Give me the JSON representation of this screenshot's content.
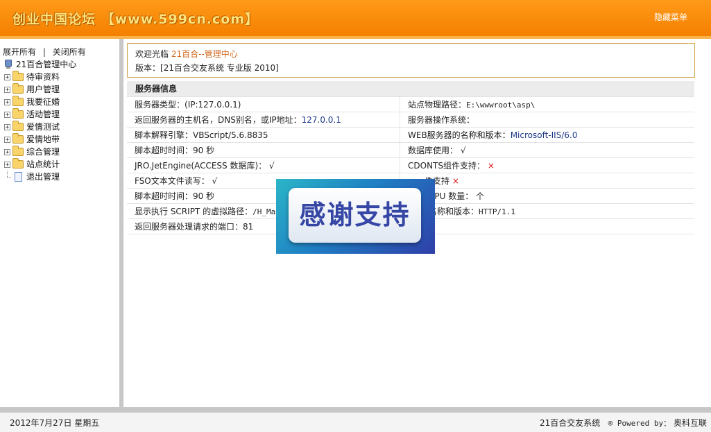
{
  "header": {
    "logo_text": "创业中国论坛 【www.599cn.com】",
    "hide_menu": "隐藏菜单"
  },
  "sidebar": {
    "expand_all": "展开所有",
    "separator": "|",
    "collapse_all": "关闭所有",
    "root": "21百合管理中心",
    "items": [
      {
        "label": "待审资料"
      },
      {
        "label": "用户管理"
      },
      {
        "label": "我要征婚"
      },
      {
        "label": "活动管理"
      },
      {
        "label": "爱情测试"
      },
      {
        "label": "爱情地带"
      },
      {
        "label": "综合管理"
      },
      {
        "label": "站点统计"
      }
    ],
    "logout": "退出管理"
  },
  "welcome": {
    "prefix": "欢迎光临",
    "center_name": "21百合--管理中心",
    "version_label": "版本：",
    "version_value": "[21百合交友系统 专业版 2010]"
  },
  "server_info": {
    "title": "服务器信息",
    "rows": [
      {
        "l_label": "服务器类型：",
        "l_value": "(IP:127.0.0.1)",
        "r_label": "站点物理路径：",
        "r_value": "E:\\wwwroot\\asp\\"
      },
      {
        "l_label": "返回服务器的主机名，DNS别名，或IP地址：",
        "l_value": "127.0.0.1",
        "r_label": "服务器操作系统：",
        "r_value": ""
      },
      {
        "l_label": "脚本解释引擎：",
        "l_value": "VBScript/5.6.8835",
        "r_label": "WEB服务器的名称和版本：",
        "r_value": "Microsoft-IIS/6.0"
      },
      {
        "l_label": "脚本超时时间：",
        "l_value": "90 秒",
        "r_label": "数据库使用：",
        "r_value": "√"
      },
      {
        "l_label": "JRO.JetEngine(ACCESS 数据库)：",
        "l_value": "√",
        "r_label": "CDONTS组件支持：",
        "r_value": "×"
      },
      {
        "l_label": "FSO文本文件读写：",
        "l_value": "√",
        "r_label": "件支持",
        "r_value": "×"
      },
      {
        "l_label": "脚本超时时间：",
        "l_value": "90 秒",
        "r_label": "CPU 数量：",
        "r_value": "个"
      },
      {
        "l_label": "显示执行 SCRIPT 的虚拟路径：",
        "l_value": "/H_Man",
        "r_label": "名称和版本：",
        "r_value": "HTTP/1.1"
      },
      {
        "l_label": "返回服务器处理请求的端口：",
        "l_value": "81"
      }
    ]
  },
  "overlay": {
    "text": "感谢支持"
  },
  "footer": {
    "date": "2012年7月27日 星期五",
    "system": "21百合交友系统",
    "powered_prefix": "® Powered by：",
    "company": "奥科互联"
  },
  "colors": {
    "header_orange": "#f57f00",
    "accent_orange": "#d2691e",
    "value_blue": "#1c3a8a",
    "cross_red": "#dd1111"
  }
}
